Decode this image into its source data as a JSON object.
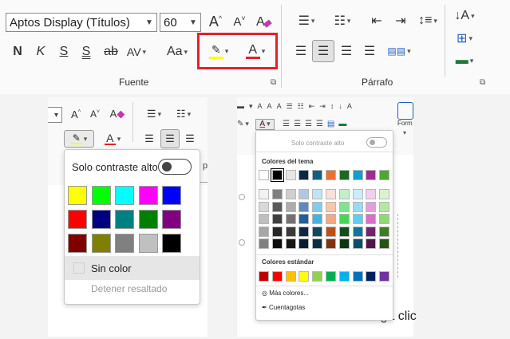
{
  "ribbon": {
    "font_name": "Aptos Display (Títulos)",
    "font_size": "60",
    "grow_font_icon": "font-grow-icon",
    "shrink_font_icon": "font-shrink-icon",
    "clear_format_icon": "clear-formatting-icon",
    "bold": "N",
    "italic": "K",
    "underline": "S",
    "double_underline": "S",
    "strikethrough": "ab",
    "spacing": "AV",
    "case": "Aa",
    "font_color_letter": "A",
    "group_font_label": "Fuente",
    "group_paragraph_label": "Párrafo",
    "highlight_color": "#ffff00",
    "font_color": "#e0232a",
    "highlight_box_color": "#e0232a"
  },
  "mini_ribbon_left": {
    "font_color_letter": "A"
  },
  "highlight_menu": {
    "high_contrast_label": "Solo contraste alto",
    "colors": [
      [
        "#ffff00",
        "#00ff00",
        "#00ffff",
        "#ff00ff",
        "#0000ff"
      ],
      [
        "#ff0000",
        "#000080",
        "#008080",
        "#008000",
        "#800080"
      ],
      [
        "#800000",
        "#808000",
        "#808080",
        "#c0c0c0",
        "#000000"
      ]
    ],
    "no_color_label": "Sin color",
    "stop_highlight_label": "Detener resaltado"
  },
  "mini_ribbon_right": {
    "font_color_letter": "A",
    "format_label": "Form",
    "doc_text": "Haga clic"
  },
  "font_color_menu": {
    "high_contrast_label": "Solo contraste alto",
    "theme_colors_label": "Colores del tema",
    "theme_colors": [
      "#ffffff",
      "#000000",
      "#e7e6e6",
      "#0e2841",
      "#156082",
      "#e97132",
      "#196b24",
      "#0f9ed5",
      "#a02b93",
      "#4ea72e"
    ],
    "theme_shades": [
      [
        "#f2f2f2",
        "#7f7f7f",
        "#d0cece",
        "#b4c6e7",
        "#c0e4f5",
        "#fbe2d5",
        "#c1f0c7",
        "#caedfb",
        "#f2cfee",
        "#daf2d0"
      ],
      [
        "#d9d9d9",
        "#595959",
        "#aeabab",
        "#5f88c2",
        "#83cbeb",
        "#f7c7ac",
        "#83e28e",
        "#95dcf7",
        "#e59edd",
        "#b5e6a2"
      ],
      [
        "#bfbfbf",
        "#3f3f3f",
        "#757070",
        "#215f9a",
        "#45b0e1",
        "#f1a983",
        "#47d459",
        "#61cbf4",
        "#d86dcb",
        "#8ed973"
      ],
      [
        "#a6a6a6",
        "#262626",
        "#3a3838",
        "#0e2841",
        "#0f4761",
        "#c04f15",
        "#124f1a",
        "#0b769f",
        "#78206e",
        "#3b7d23"
      ],
      [
        "#808080",
        "#0d0d0d",
        "#171616",
        "#0a1c2d",
        "#0a2f40",
        "#80340e",
        "#0c3512",
        "#074f6a",
        "#501549",
        "#275317"
      ]
    ],
    "standard_colors_label": "Colores estándar",
    "standard_colors": [
      "#c00000",
      "#ff0000",
      "#ffc000",
      "#ffff00",
      "#92d050",
      "#00b050",
      "#00b0f0",
      "#0070c0",
      "#002060",
      "#7030a0"
    ],
    "more_colors_label": "Más colores...",
    "eyedropper_label": "Cuentagotas"
  }
}
